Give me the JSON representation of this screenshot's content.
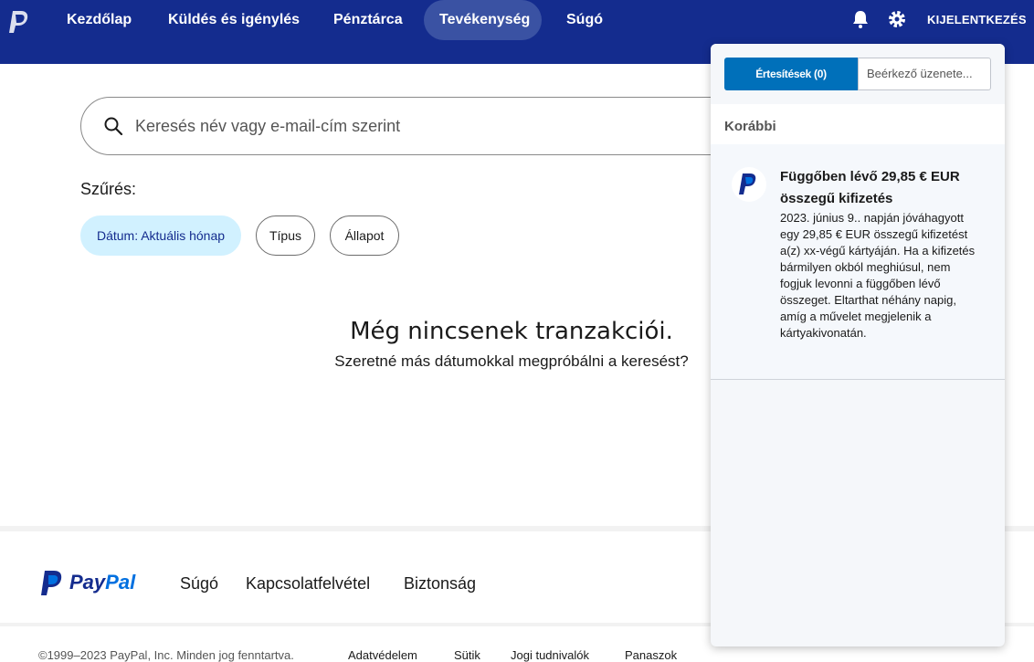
{
  "nav": {
    "items": [
      "Kezdőlap",
      "Küldés és igénylés",
      "Pénztárca",
      "Tevékenység",
      "Súgó"
    ],
    "active": "Tevékenység",
    "logout": "KIJELENTKEZÉS",
    "icons": [
      "paypal-logo-icon",
      "bell-icon",
      "gear-icon"
    ]
  },
  "search": {
    "placeholder": "Keresés név vagy e-mail-cím szerint"
  },
  "filters": {
    "label": "Szűrés:",
    "chips": [
      "Dátum: Aktuális hónap",
      "Típus",
      "Állapot"
    ]
  },
  "empty": {
    "title": "Még nincsenek tranzakciói.",
    "subtitle": "Szeretné más dátumokkal megpróbálni a keresést?"
  },
  "footer": {
    "brand_pay": "Pay",
    "brand_pal": "Pal",
    "links": [
      "Súgó",
      "Kapcsolatfelvétel",
      "Biztonság"
    ],
    "copyright": "©1999–2023 PayPal, Inc. Minden jog fenntartva.",
    "bottom_links": [
      "Adatvédelem",
      "Sütik",
      "Jogi tudnivalók",
      "Panaszok"
    ]
  },
  "panel": {
    "tab_notifications": "Értesítések (0)",
    "tab_inbox": "Beérkező üzenete...",
    "section": "Korábbi",
    "notification": {
      "title": "Függőben lévő 29,85 € EUR összegű kifizetés",
      "body": "2023. június 9.. napján jóváhagyott egy 29,85 € EUR összegű kifizetést a(z) xx-végű kártyáján. Ha a kifizetés bármilyen okból meghiúsul, nem fogjuk levonni a függőben lévő összeget. Eltarthat néhány napig, amíg a művelet megjelenik a kártyakivonatán."
    }
  },
  "colors": {
    "nav_bg": "#142c8e",
    "accent": "#0070ba",
    "chip_active_bg": "#d1f1ff"
  }
}
